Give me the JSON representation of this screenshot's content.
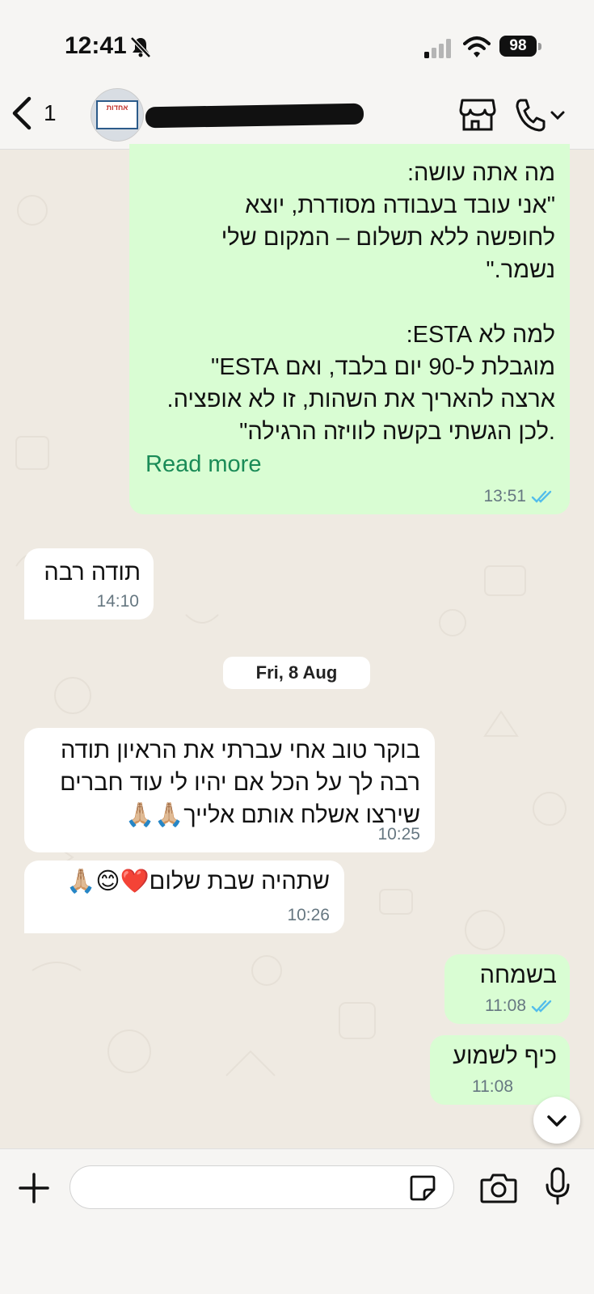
{
  "status_bar": {
    "time": "12:41",
    "battery": "98"
  },
  "header": {
    "back_count": "1",
    "avatar_text": "אחדות"
  },
  "messages": [
    {
      "direction": "out",
      "text": "מה אתה עושה:\n\"אני עובד בעבודה מסודרת, יוצא\nלחופשה ללא תשלום – המקום שלי\nנשמר.\"\n\nלמה לא ESTA:\nמוגבלת ל-90 יום בלבד, ואם ESTA\"\nארצה להאריך את השהות, זו לא אופציה.\n.לכן הגשתי בקשה לוויזה הרגילה\"",
      "read_more": "Read more",
      "time": "13:51",
      "status": "read"
    },
    {
      "direction": "in",
      "text": "תודה רבה",
      "time": "14:10"
    },
    {
      "direction": "in",
      "text": "בוקר טוב אחי עברתי את הראיון תודה\nרבה לך על הכל אם יהיו לי עוד חברים\nשירצו אשלח אותם אלייך🙏🏼🙏🏼",
      "time": "10:25"
    },
    {
      "direction": "in",
      "text": "שתהיה שבת שלום❤️😊🙏🏼",
      "time": "10:26"
    },
    {
      "direction": "out",
      "text": "בשמחה",
      "time": "11:08",
      "status": "read"
    },
    {
      "direction": "out",
      "text": "כיף לשמוע",
      "time": "11:08",
      "status": "read"
    }
  ],
  "date_separator": "Fri, 8 Aug",
  "input": {
    "value": "",
    "placeholder": ""
  },
  "colors": {
    "outgoing_bubble": "#d9fdd3",
    "incoming_bubble": "#ffffff",
    "background": "#efeae2",
    "read_ticks": "#53bdeb",
    "read_more": "#1a8b57"
  },
  "icons": [
    "bell-slash-icon",
    "signal-icon",
    "wifi-icon",
    "battery-icon",
    "back-chevron-icon",
    "store-icon",
    "phone-icon",
    "chevron-down-icon",
    "plus-icon",
    "sticker-icon",
    "camera-icon",
    "mic-icon",
    "double-check-icon"
  ]
}
